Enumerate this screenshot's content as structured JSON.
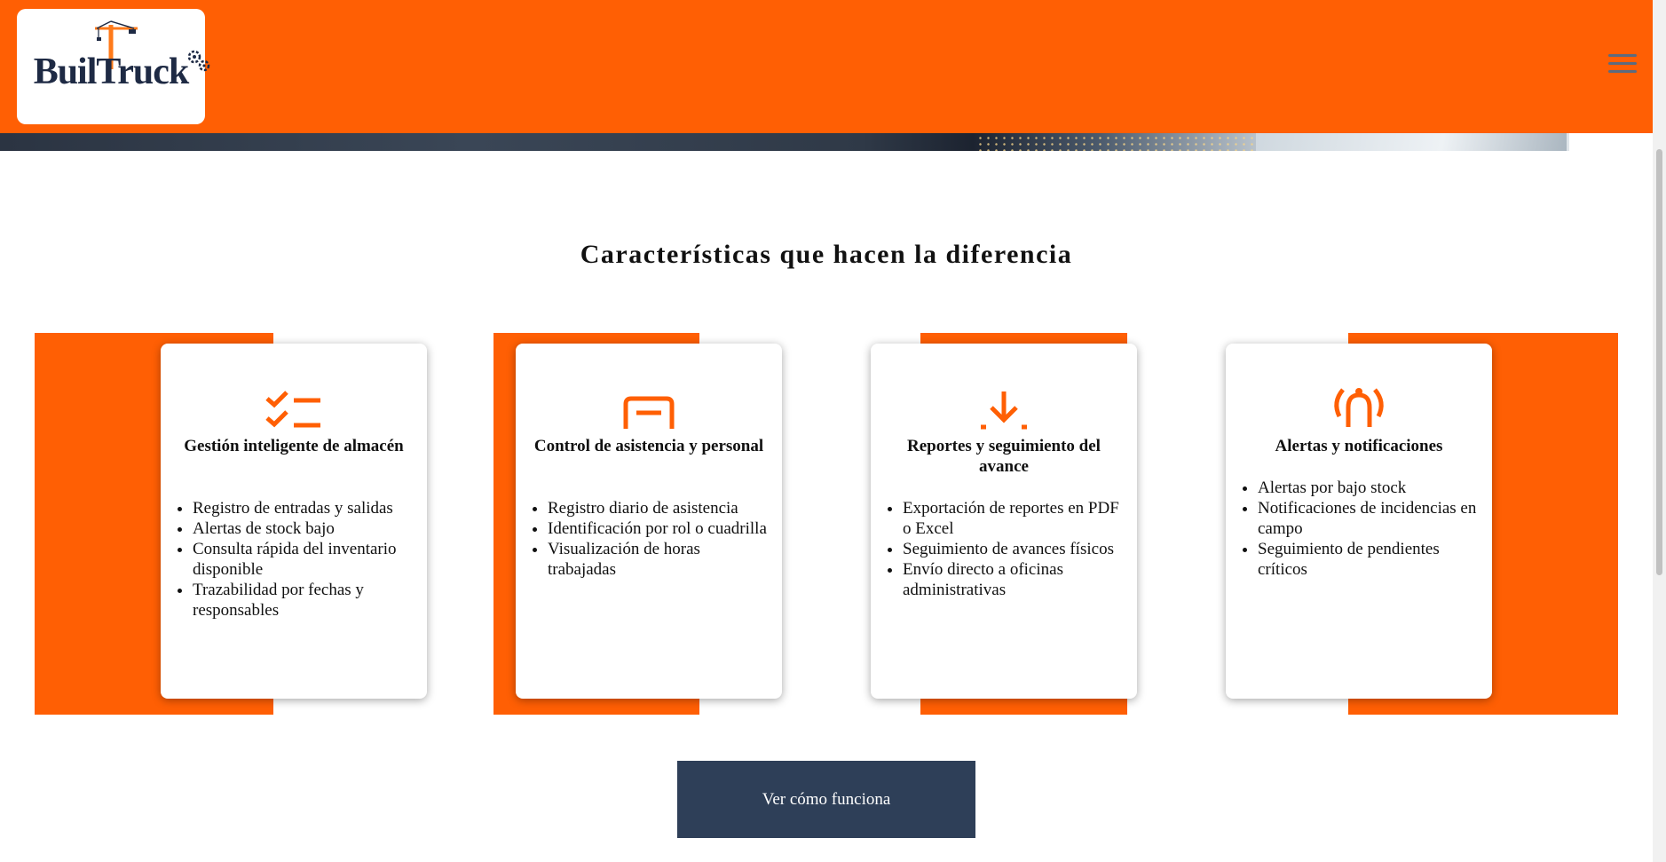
{
  "colors": {
    "brand": "#ff5f04",
    "navy": "#2e3f58",
    "logo_text": "#1e2a44"
  },
  "header": {
    "logo_text": "BuilTruck",
    "menu_icon": "hamburger-menu-icon"
  },
  "features": {
    "title": "Características que hacen la diferencia",
    "cards": [
      {
        "icon": "checklist-icon",
        "title": "Gestión inteligente de almacén",
        "items": [
          "Registro de entradas y salidas",
          "Alertas de stock bajo",
          "Consulta rápida del inventario disponible",
          "Trazabilidad por fechas y responsables"
        ]
      },
      {
        "icon": "badge-icon",
        "title": "Control de asistencia y personal",
        "items": [
          "Registro diario de asistencia",
          "Identificación por rol o cuadrilla",
          "Visualización de horas trabajadas"
        ]
      },
      {
        "icon": "download-icon",
        "title": "Reportes y seguimiento del avance",
        "items": [
          "Exportación de reportes en PDF o Excel",
          "Seguimiento de avances físicos",
          "Envío directo a oficinas administrativas"
        ]
      },
      {
        "icon": "alert-signal-icon",
        "title": "Alertas y notificaciones",
        "items": [
          "Alertas por bajo stock",
          "Notificaciones de incidencias en campo",
          "Seguimiento de pendientes críticos"
        ]
      }
    ]
  },
  "cta": {
    "label": "Ver cómo funciona"
  }
}
